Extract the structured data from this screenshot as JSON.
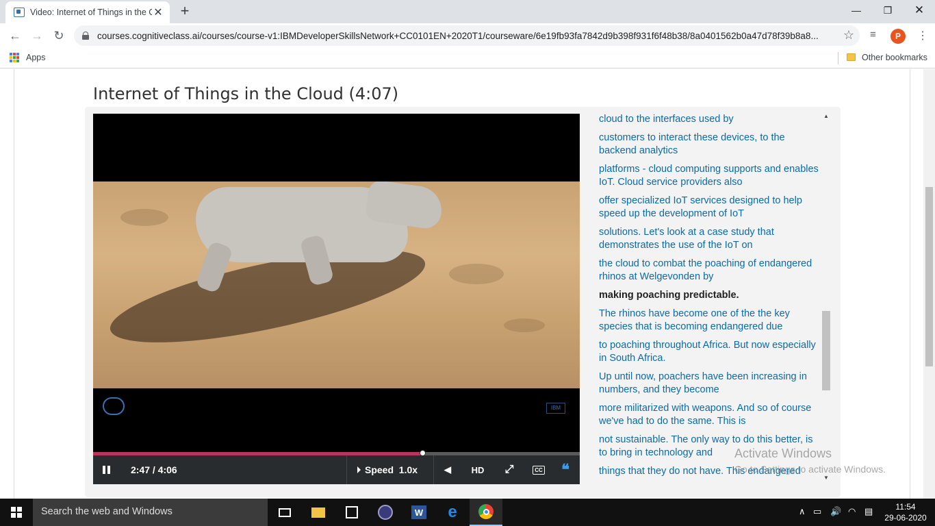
{
  "browser": {
    "tab_title": "Video: Internet of Things in the C",
    "url": "courses.cognitiveclass.ai/courses/course-v1:IBMDeveloperSkillsNetwork+CC0101EN+2020T1/courseware/6e19fb93fa7842d9b398f931f6f48b38/8a0401562b0a47d78f39b8a8...",
    "profile_initial": "P",
    "bookmarks": {
      "apps_label": "Apps",
      "other_label": "Other bookmarks"
    }
  },
  "page": {
    "title": "Internet of Things in the Cloud (4:07)"
  },
  "video": {
    "time": "2:47 / 4:06",
    "progress": 0.678,
    "speed_label": "Speed",
    "speed_value": "1.0x",
    "hd_label": "HD",
    "cc_label": "CC"
  },
  "transcript": {
    "lines": [
      "cloud to the interfaces used by",
      "customers to interact these devices, to the backend analytics",
      "platforms - cloud computing supports and enables IoT. Cloud service providers also",
      "offer specialized IoT services designed to help speed up the development of IoT",
      "solutions. Let's look at a case study that demonstrates the use of the IoT on",
      "the cloud to combat the poaching of endangered rhinos at Welgevonden by",
      "making poaching predictable.",
      "The rhinos have become one of the the key species that is becoming endangered due",
      "to poaching throughout Africa. But now especially in South Africa.",
      "Up until now, poachers have been increasing in numbers, and they become",
      "more militarized with weapons. And so of course we've had to do the same. This is",
      "not sustainable. The only way to do this better, is to bring in technology and",
      "things that they do not have. This endangered"
    ],
    "active_index": 6
  },
  "watermark": {
    "line1": "Activate Windows",
    "line2": "Go to Settings to activate Windows."
  },
  "taskbar": {
    "search_placeholder": "Search the web and Windows",
    "time": "11:54",
    "date": "29-06-2020"
  }
}
